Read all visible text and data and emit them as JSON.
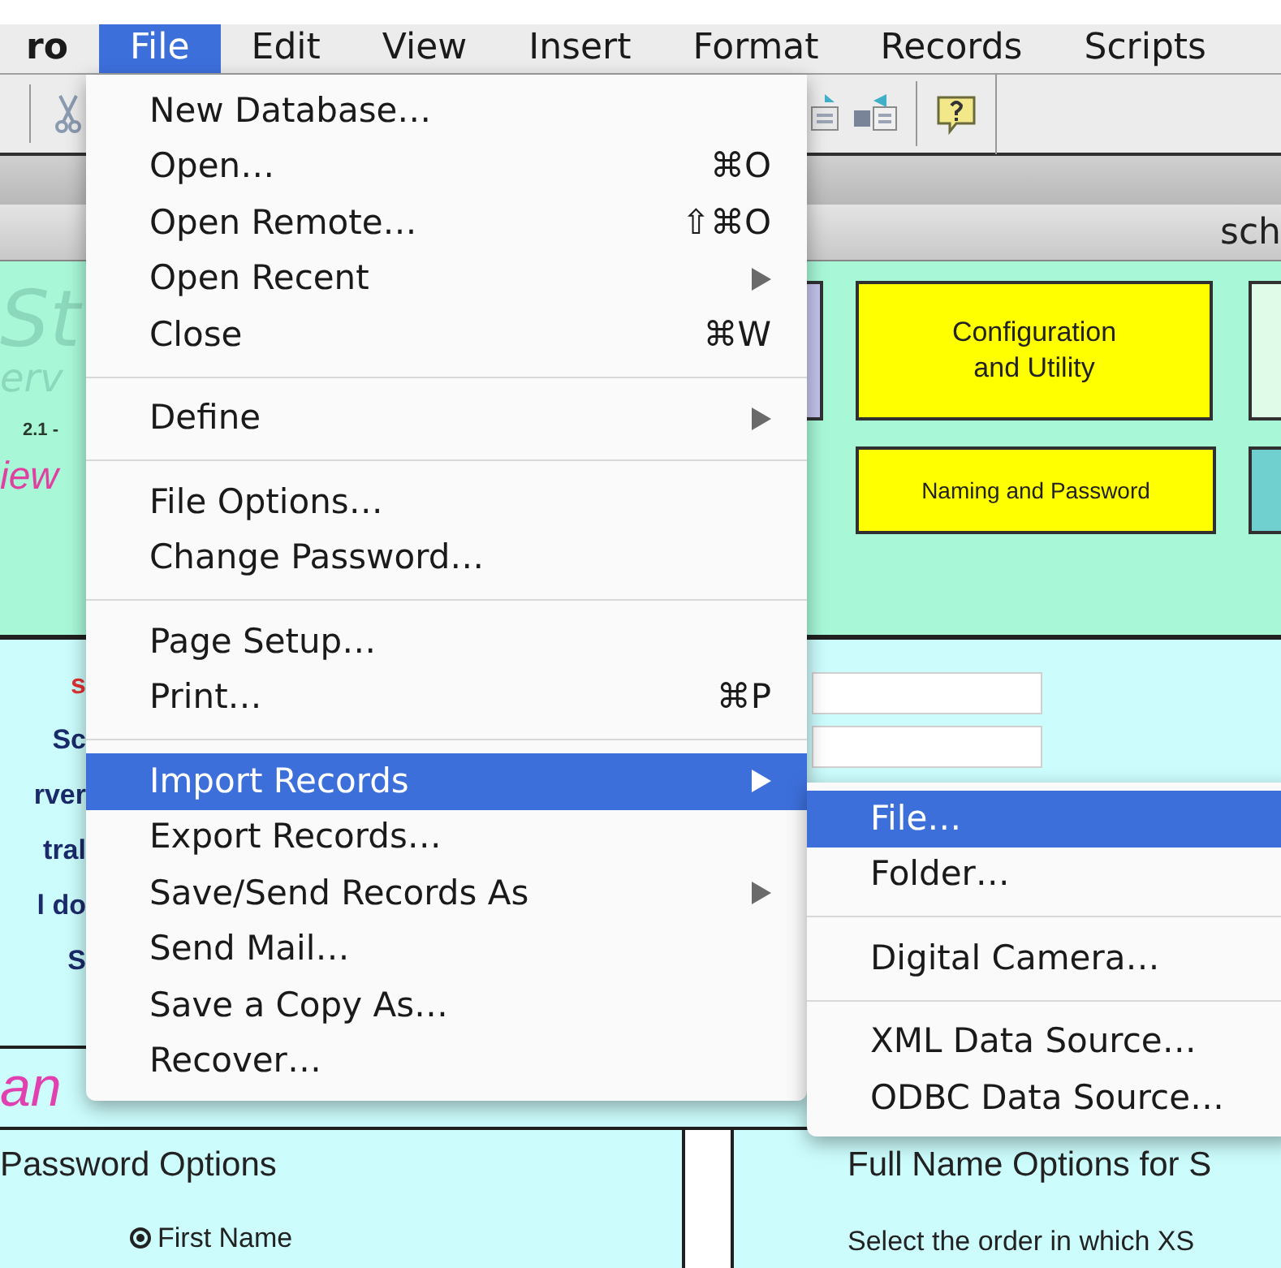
{
  "menubar": [
    {
      "label": "ro",
      "selected": false
    },
    {
      "label": "File",
      "selected": true
    },
    {
      "label": "Edit",
      "selected": false
    },
    {
      "label": "View",
      "selected": false
    },
    {
      "label": "Insert",
      "selected": false
    },
    {
      "label": "Format",
      "selected": false
    },
    {
      "label": "Records",
      "selected": false
    },
    {
      "label": "Scripts",
      "selected": false
    }
  ],
  "window": {
    "title": "sch"
  },
  "header": {
    "logo": "St",
    "subtitle": "erv",
    "version": "2.1 -",
    "tagline": "iew"
  },
  "nav_buttons": [
    {
      "label": "Configuration and Utility"
    },
    {
      "label": "Naming and Password"
    }
  ],
  "form_labels": [
    {
      "label": "s",
      "color": "#e03030"
    },
    {
      "label": "Sc",
      "color": "#1a2a6a"
    },
    {
      "label": "rver",
      "color": "#1a2a6a"
    },
    {
      "label": "tral",
      "color": "#1a2a6a"
    },
    {
      "label": "l do",
      "color": "#1a2a6a"
    },
    {
      "label": "S",
      "color": "#1a2a6a"
    }
  ],
  "section_title": "an",
  "password_options": {
    "title": "Password Options",
    "options": [
      {
        "label": "First Name",
        "selected": true
      }
    ]
  },
  "full_name_options": {
    "title": "Full Name Options for S",
    "hint": "Select the order in which XS"
  },
  "file_menu": [
    {
      "kind": "item",
      "label": "New Database…",
      "selected": false
    },
    {
      "kind": "item",
      "label": "Open…",
      "shortcut": "⌘O",
      "selected": false
    },
    {
      "kind": "item",
      "label": "Open Remote…",
      "shortcut": "⇧⌘O",
      "selected": false
    },
    {
      "kind": "item",
      "label": "Open Recent",
      "submenu": true,
      "selected": false
    },
    {
      "kind": "item",
      "label": "Close",
      "shortcut": "⌘W",
      "selected": false
    },
    {
      "kind": "separator"
    },
    {
      "kind": "item",
      "label": "Define",
      "submenu": true,
      "selected": false
    },
    {
      "kind": "separator"
    },
    {
      "kind": "item",
      "label": "File Options…",
      "selected": false
    },
    {
      "kind": "item",
      "label": "Change Password…",
      "selected": false
    },
    {
      "kind": "separator"
    },
    {
      "kind": "item",
      "label": "Page Setup…",
      "selected": false
    },
    {
      "kind": "item",
      "label": "Print…",
      "shortcut": "⌘P",
      "selected": false
    },
    {
      "kind": "separator"
    },
    {
      "kind": "item",
      "label": "Import Records",
      "submenu": true,
      "selected": true
    },
    {
      "kind": "item",
      "label": "Export Records…",
      "selected": false
    },
    {
      "kind": "item",
      "label": "Save/Send Records As",
      "submenu": true,
      "selected": false
    },
    {
      "kind": "item",
      "label": "Send Mail…",
      "selected": false
    },
    {
      "kind": "item",
      "label": "Save a Copy As…",
      "selected": false
    },
    {
      "kind": "item",
      "label": "Recover…",
      "selected": false
    }
  ],
  "import_submenu": [
    {
      "kind": "item",
      "label": "File…",
      "selected": true
    },
    {
      "kind": "item",
      "label": "Folder…",
      "selected": false
    },
    {
      "kind": "separator"
    },
    {
      "kind": "item",
      "label": "Digital Camera…",
      "selected": false
    },
    {
      "kind": "separator"
    },
    {
      "kind": "item",
      "label": "XML Data Source…",
      "selected": false
    },
    {
      "kind": "item",
      "label": "ODBC Data Source…",
      "selected": false
    }
  ]
}
